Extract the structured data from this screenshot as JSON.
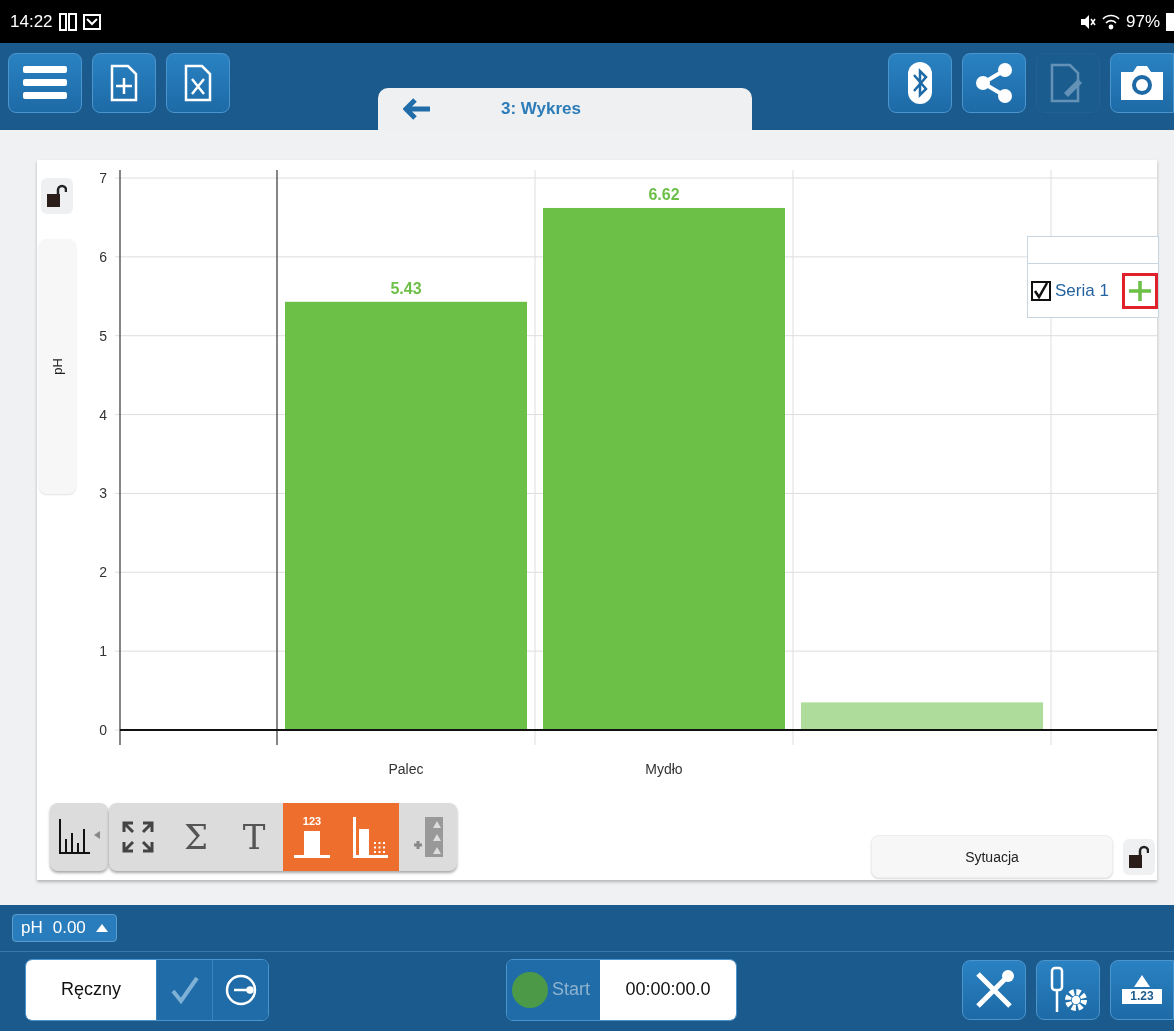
{
  "status_bar": {
    "time": "14:22",
    "battery": "97%"
  },
  "toolbar": {
    "left_buttons": [
      {
        "kind": "menu"
      },
      {
        "kind": "new-file"
      },
      {
        "kind": "spreadsheet"
      }
    ],
    "right_buttons": [
      {
        "kind": "bluetooth",
        "disabled": false
      },
      {
        "kind": "share",
        "disabled": false
      },
      {
        "kind": "annotate",
        "disabled": true
      },
      {
        "kind": "camera",
        "disabled": false
      }
    ]
  },
  "tab": {
    "title": "3: Wykres"
  },
  "chart": {
    "chart_data": {
      "type": "bar",
      "ylabel": "pH",
      "categories": [
        "Palec",
        "Mydło"
      ],
      "series": [
        {
          "name": "Seria 1",
          "color": "#6cbf47",
          "values": [
            5.43,
            6.62
          ]
        }
      ],
      "ylim": [
        0,
        7
      ],
      "yticks": [
        0,
        1,
        2,
        3,
        4,
        5,
        6,
        7
      ],
      "data_labels": true,
      "grid": true
    },
    "legend": [
      {
        "checked": true
      }
    ]
  },
  "chart_tools": [
    {
      "kind": "chart-type",
      "selected": false
    },
    {
      "kind": "zoom-fit",
      "selected": false
    },
    {
      "kind": "sum",
      "glyph": "Σ",
      "selected": false
    },
    {
      "kind": "text",
      "glyph": "T",
      "selected": false
    },
    {
      "kind": "value-labels",
      "glyph": "123",
      "selected": true
    },
    {
      "kind": "bar-style",
      "selected": true
    },
    {
      "kind": "add-table",
      "selected": false
    }
  ],
  "situation_button": "Sytuacja",
  "sensor_chip": {
    "label": "pH",
    "value": "0.00"
  },
  "mode": {
    "label": "Ręczny"
  },
  "timer": {
    "start": "Start",
    "time": "00:00:00.0"
  },
  "right_tools": [
    {
      "kind": "tools"
    },
    {
      "kind": "probe-settings"
    },
    {
      "kind": "meter",
      "label": "1.23"
    }
  ]
}
